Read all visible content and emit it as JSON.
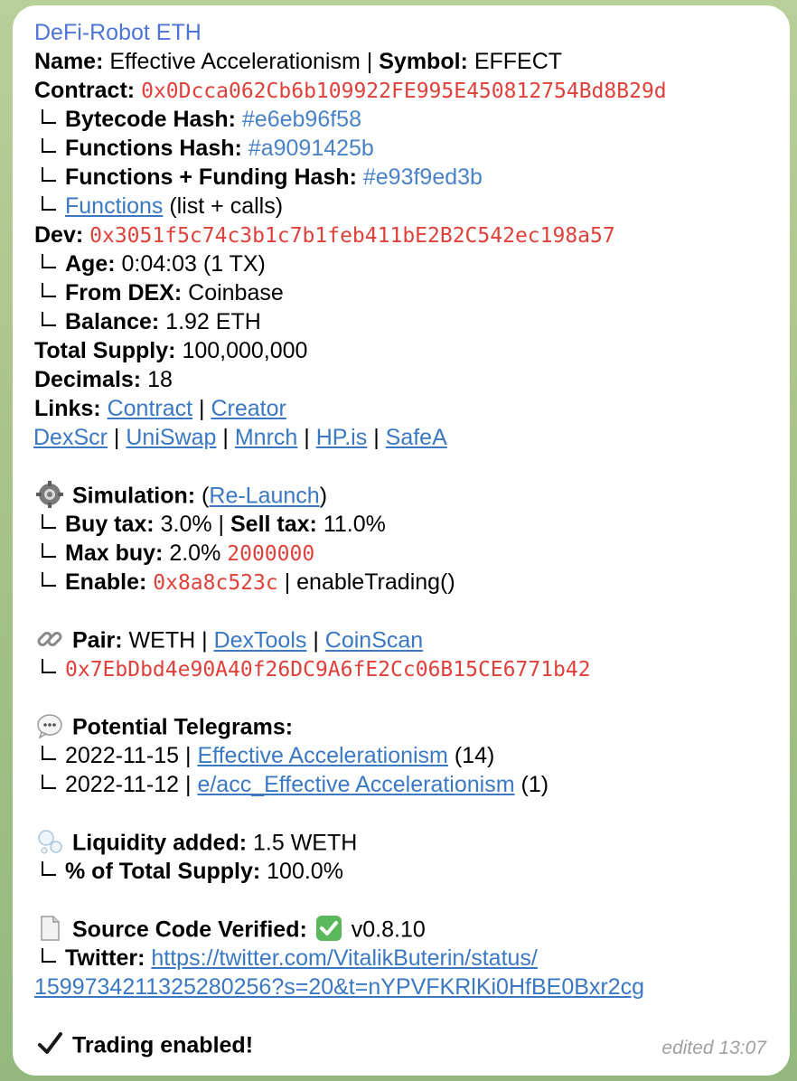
{
  "bot_name": "DeFi-Robot ETH",
  "name_label": "Name:",
  "name_value": "Effective Accelerationism",
  "symbol_label": "Symbol:",
  "symbol_value": "EFFECT",
  "contract_label": "Contract:",
  "contract_value": "0x0Dcca062Cb6b109922FE995E450812754Bd8B29d",
  "bytecode_label": "Bytecode Hash:",
  "bytecode_value": "#e6eb96f58",
  "functions_hash_label": "Functions Hash:",
  "functions_hash_value": "#a9091425b",
  "funding_hash_label": "Functions + Funding Hash:",
  "funding_hash_value": "#e93f9ed3b",
  "functions_link": "Functions",
  "functions_suffix": "(list + calls)",
  "dev_label": "Dev:",
  "dev_value": "0x3051f5c74c3b1c7b1feb411bE2B2C542ec198a57",
  "age_label": "Age:",
  "age_value": "0:04:03 (1 TX)",
  "from_dex_label": "From DEX:",
  "from_dex_value": "Coinbase",
  "balance_label": "Balance:",
  "balance_value": "1.92 ETH",
  "total_supply_label": "Total Supply:",
  "total_supply_value": "100,000,000",
  "decimals_label": "Decimals:",
  "decimals_value": "18",
  "links_label": "Links:",
  "links": {
    "contract": "Contract",
    "creator": "Creator",
    "dexscr": "DexScr",
    "uniswap": "UniSwap",
    "mnrch": "Mnrch",
    "hpis": "HP.is",
    "safea": "SafeA"
  },
  "sim_label": "Simulation:",
  "sim_relaunch": "Re-Launch",
  "buy_tax_label": "Buy tax:",
  "buy_tax_value": "3.0%",
  "sell_tax_label": "Sell tax:",
  "sell_tax_value": "11.0%",
  "max_buy_label": "Max buy:",
  "max_buy_pct": "2.0%",
  "max_buy_amount": "2000000",
  "enable_label": "Enable:",
  "enable_sig": "0x8a8c523c",
  "enable_fn": "enableTrading()",
  "pair_label": "Pair:",
  "pair_value": "WETH",
  "pair_dextools": "DexTools",
  "pair_coinscan": "CoinScan",
  "pair_address": "0x7EbDbd4e90A40f26DC9A6fE2Cc06B15CE6771b42",
  "tg_label": "Potential Telegrams:",
  "tg1_date": "2022-11-15",
  "tg1_name": "Effective Accelerationism",
  "tg1_count": "(14)",
  "tg2_date": "2022-11-12",
  "tg2_name": "e/acc_Effective Accelerationism",
  "tg2_count": "(1)",
  "liq_label": "Liquidity added:",
  "liq_value": "1.5 WETH",
  "pct_supply_label": "% of Total Supply:",
  "pct_supply_value": "100.0%",
  "src_label": "Source Code Verified:",
  "src_version": "v0.8.10",
  "twitter_label": "Twitter:",
  "twitter_url_1": "https://twitter.com/VitalikButerin/status/",
  "twitter_url_2": "1599734211325280256?s=20&t=nYPVFKRlKi0HfBE0Bxr2cg",
  "trading_label": "Trading enabled!",
  "edited": "edited 13:07",
  "sep": "|"
}
